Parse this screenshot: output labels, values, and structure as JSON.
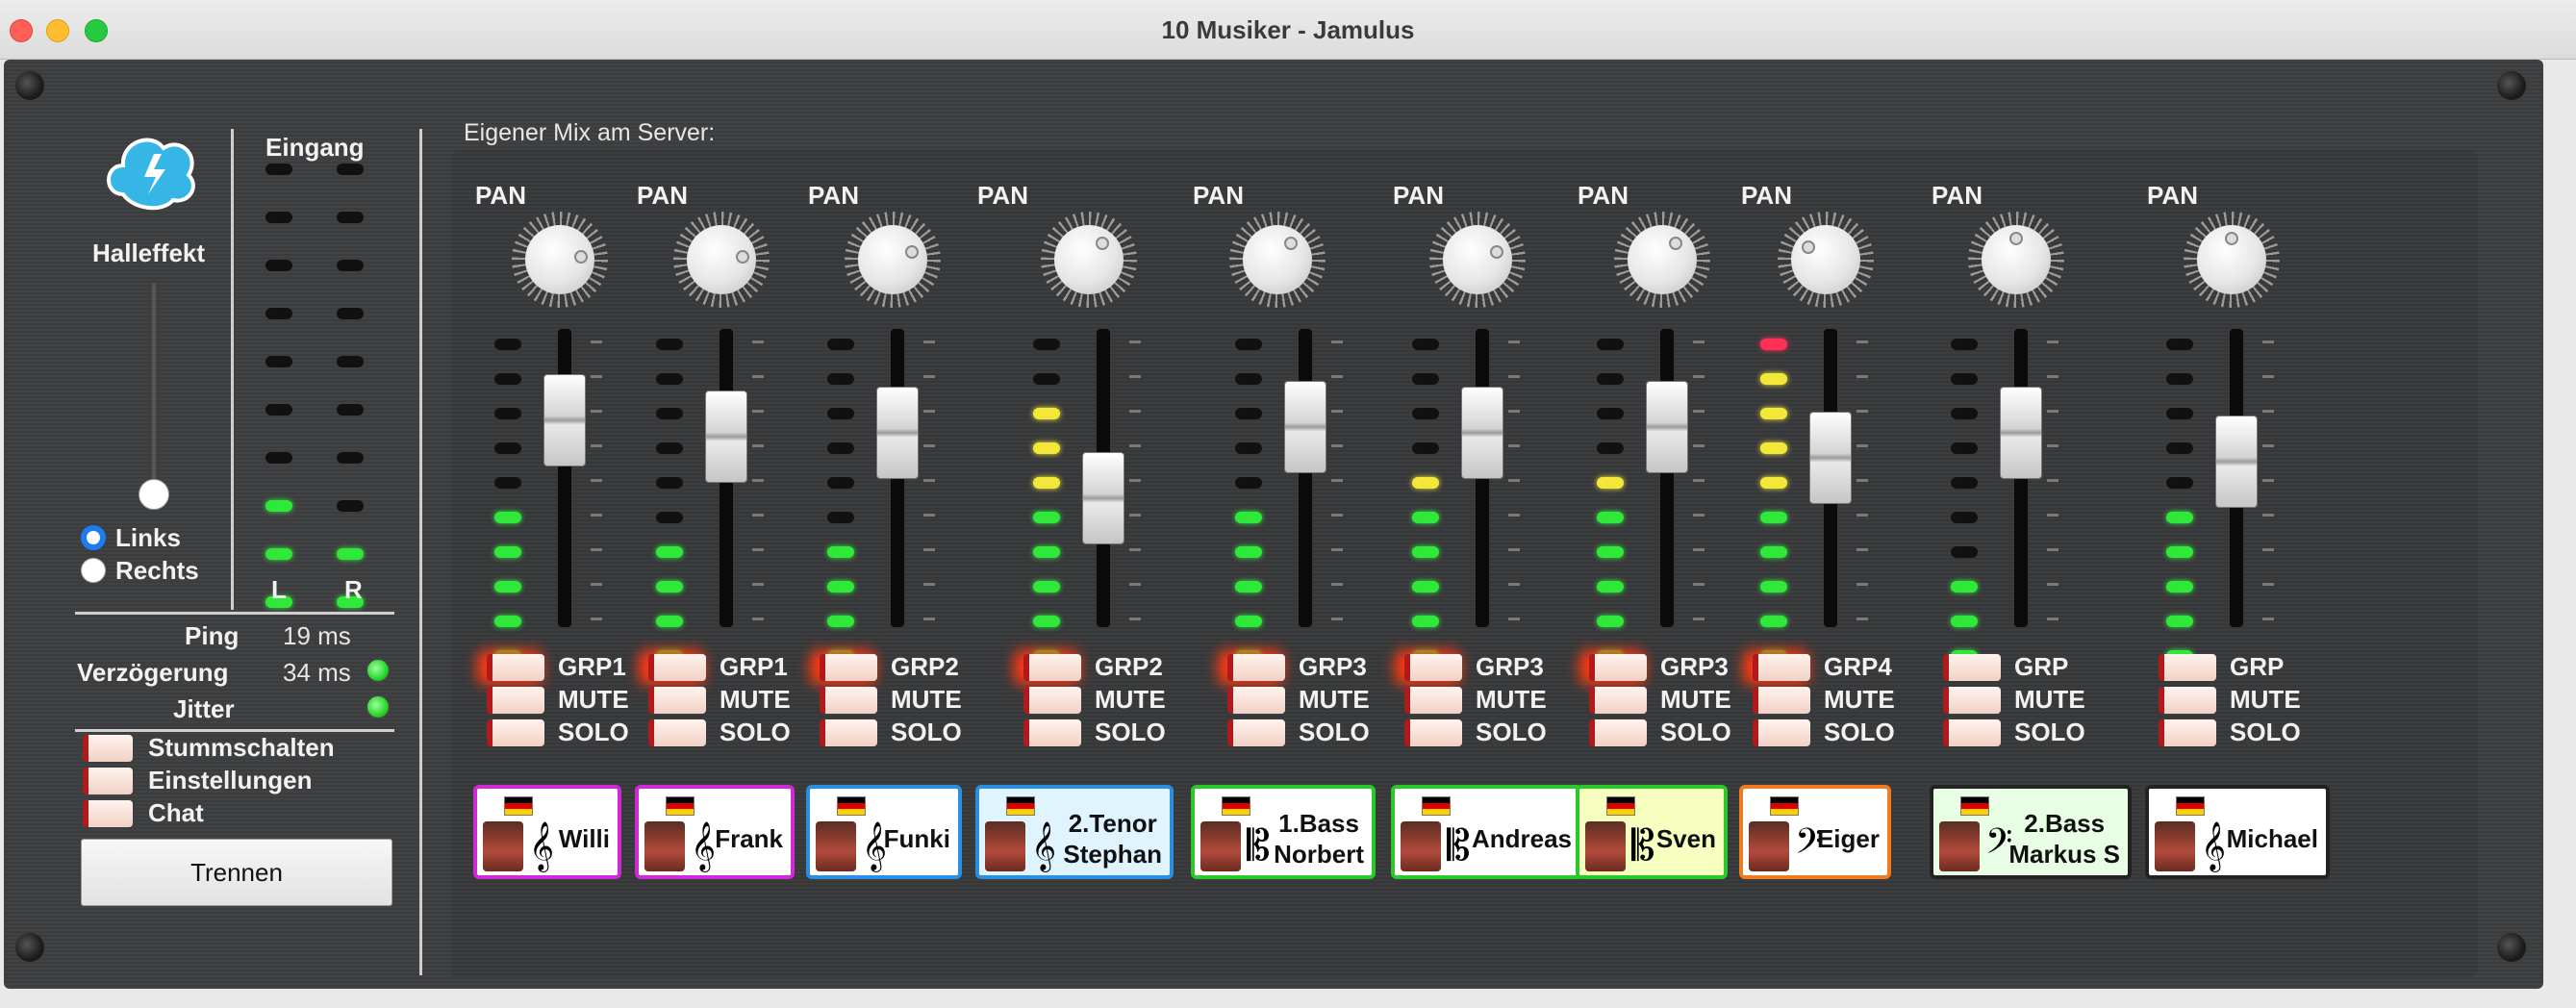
{
  "window": {
    "title": "10 Musiker - Jamulus"
  },
  "left": {
    "reverb_label": "Halleffekt",
    "input_label": "Eingang",
    "channel_l": "L",
    "channel_r": "R",
    "radio_left": "Links",
    "radio_right": "Rechts",
    "ping_label": "Ping",
    "ping_value": "19 ms",
    "delay_label": "Verzögerung",
    "delay_value": "34 ms",
    "jitter_label": "Jitter",
    "mute_self": "Stummschalten",
    "settings": "Einstellungen",
    "chat": "Chat",
    "disconnect": "Trennen"
  },
  "mixer": {
    "title": "Eigener Mix am Server:",
    "pan_label": "PAN",
    "mute_label": "MUTE",
    "solo_label": "SOLO",
    "channels": [
      {
        "name1": "Willi",
        "name2": "",
        "group": "GRP1",
        "clef": "𝄞",
        "border": "#d02ad6",
        "bg": "#ffffff",
        "level": 0.45,
        "fader": 0.78,
        "pan": 0.8
      },
      {
        "name1": "Frank",
        "name2": "",
        "group": "GRP1",
        "clef": "𝄞",
        "border": "#d02ad6",
        "bg": "#ffffff",
        "level": 0.35,
        "fader": 0.7,
        "pan": 0.8
      },
      {
        "name1": "Funki",
        "name2": "",
        "group": "GRP2",
        "clef": "𝄞",
        "border": "#2a8fe0",
        "bg": "#ffffff",
        "level": 0.35,
        "fader": 0.72,
        "pan": 0.75
      },
      {
        "name1": "2.Tenor",
        "name2": "Stephan",
        "group": "GRP2",
        "clef": "𝄞",
        "border": "#2a8fe0",
        "bg": "#dff4ff",
        "level": 0.8,
        "fader": 0.4,
        "pan": 0.65
      },
      {
        "name1": "1.Bass",
        "name2": "Norbert",
        "group": "GRP3",
        "clef": "𝄡",
        "border": "#2ac82a",
        "bg": "#ffffff",
        "level": 0.45,
        "fader": 0.75,
        "pan": 0.65
      },
      {
        "name1": "Andreas",
        "name2": "",
        "group": "GRP3",
        "clef": "𝄡",
        "border": "#2ac82a",
        "bg": "#ffffff",
        "level": 0.6,
        "fader": 0.72,
        "pan": 0.75
      },
      {
        "name1": "Sven",
        "name2": "",
        "group": "GRP3",
        "clef": "𝄡",
        "border": "#2ac82a",
        "bg": "#f6ffc0",
        "level": 0.6,
        "fader": 0.75,
        "pan": 0.65
      },
      {
        "name1": "Eiger",
        "name2": "",
        "group": "GRP4",
        "clef": "𝄢",
        "border": "#f07a20",
        "bg": "#ffffff",
        "level": 1.0,
        "fader": 0.6,
        "pan": 0.3
      },
      {
        "name1": "2.Bass",
        "name2": "Markus S",
        "group": "GRP",
        "clef": "𝄢",
        "border": "#222222",
        "bg": "#e8ffe6",
        "level": 0.25,
        "fader": 0.72,
        "pan": 0.5
      },
      {
        "name1": "Michael",
        "name2": "",
        "group": "GRP",
        "clef": "𝄞",
        "border": "#222222",
        "bg": "#ffffff",
        "level": 0.45,
        "fader": 0.58,
        "pan": 0.5
      }
    ]
  },
  "colors": {
    "accent": "#1d7cf2",
    "panel": "#3d3e40"
  }
}
